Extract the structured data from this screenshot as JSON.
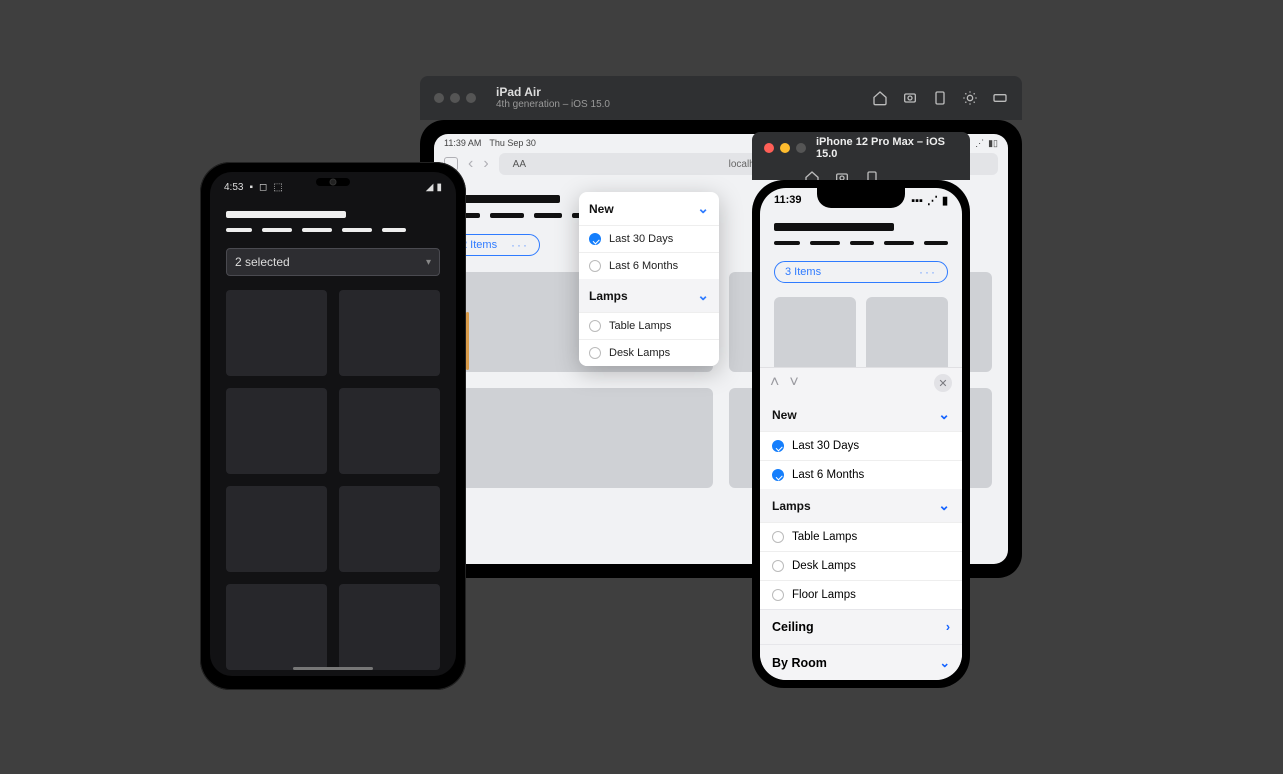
{
  "ipad": {
    "sim_title": "iPad Air",
    "sim_subtitle": "4th generation – iOS 15.0",
    "status_time": "11:39 AM",
    "status_date": "Thu Sep 30",
    "address_aa": "AA",
    "address_host": "localhost",
    "items_label": "2 Items",
    "items_dots": "···",
    "popover": {
      "group1_title": "New",
      "row1": "Last 30 Days",
      "row2": "Last 6 Months",
      "group2_title": "Lamps",
      "row3": "Table Lamps",
      "row4": "Desk Lamps"
    }
  },
  "iphone": {
    "sim_title": "iPhone 12 Pro Max – iOS 15.0",
    "status_time": "11:39",
    "items_label": "3 Items",
    "items_dots": "···",
    "sheet": {
      "group1_title": "New",
      "row1": "Last 30 Days",
      "row2": "Last 6 Months",
      "group2_title": "Lamps",
      "row3": "Table Lamps",
      "row4": "Desk Lamps",
      "row5": "Floor Lamps",
      "row6": "Ceiling",
      "row7": "By Room"
    }
  },
  "android": {
    "status_time": "4:53",
    "select_label": "2 selected"
  }
}
